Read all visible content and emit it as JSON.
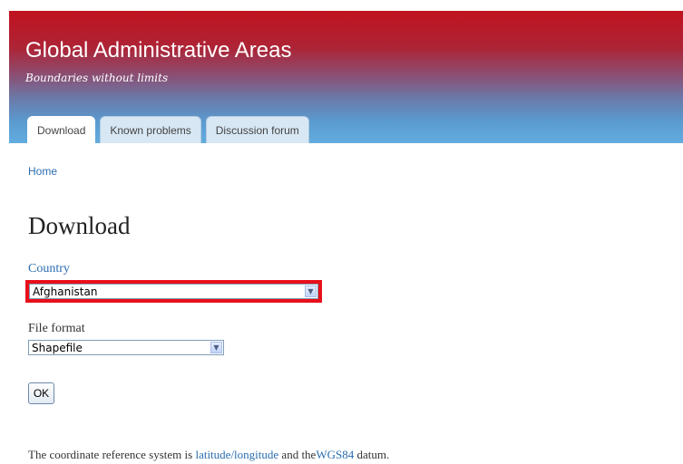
{
  "header": {
    "site_name": "Global Administrative Areas",
    "slogan": "Boundaries without limits",
    "gradient_top": "#c1121f",
    "gradient_bottom": "#62acdf"
  },
  "tabs": [
    {
      "label": "Download",
      "active": true
    },
    {
      "label": "Known problems",
      "active": false
    },
    {
      "label": "Discussion forum",
      "active": false
    }
  ],
  "breadcrumb": "Home",
  "page": {
    "title": "Download"
  },
  "form": {
    "country": {
      "label": "Country",
      "value": "Afghanistan",
      "highlight_color": "#e8101b"
    },
    "file_format": {
      "label": "File format",
      "value": "Shapefile"
    },
    "submit_label": "OK"
  },
  "footer": {
    "text_before": "The coordinate reference system is ",
    "link_latlon": "latitude/longitude",
    "text_middle": " and the",
    "link_wgs84": "WGS84",
    "text_after": " datum."
  },
  "colors": {
    "link": "#2a6db0"
  }
}
